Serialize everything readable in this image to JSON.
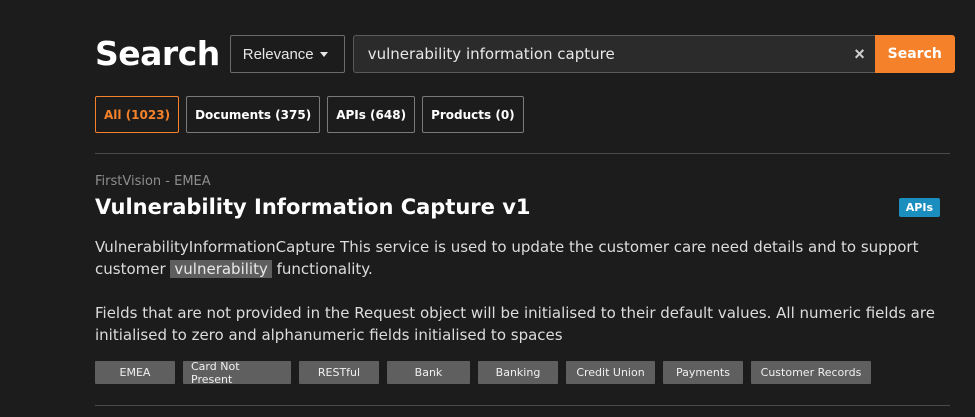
{
  "header": {
    "title": "Search",
    "sort_label": "Relevance",
    "search_value": "vulnerability information capture",
    "clear_label": "×",
    "search_button": "Search"
  },
  "filters": [
    {
      "label": "All (1023)",
      "active": true
    },
    {
      "label": "Documents (375)",
      "active": false
    },
    {
      "label": "APIs (648)",
      "active": false
    },
    {
      "label": "Products (0)",
      "active": false
    }
  ],
  "result": {
    "source": "FirstVision - EMEA",
    "title": "Vulnerability Information Capture v1",
    "type_badge": "APIs",
    "desc_part1": "VulnerabilityInformationCapture This service is used to update the customer care need details and to support customer ",
    "desc_highlight": "vulnerability",
    "desc_part2": " functionality.",
    "desc_second": "Fields that are not provided in the Request object will be initialised to their default values. All numeric fields are initialised to zero and alphanumeric fields initialised to spaces",
    "tags": [
      "EMEA",
      "Card Not Present",
      "RESTful",
      "Bank",
      "Banking",
      "Credit Union",
      "Payments",
      "Customer Records"
    ]
  },
  "colors": {
    "accent": "#f5822b",
    "badge": "#1b8ec0",
    "background": "#1c1c1c"
  }
}
